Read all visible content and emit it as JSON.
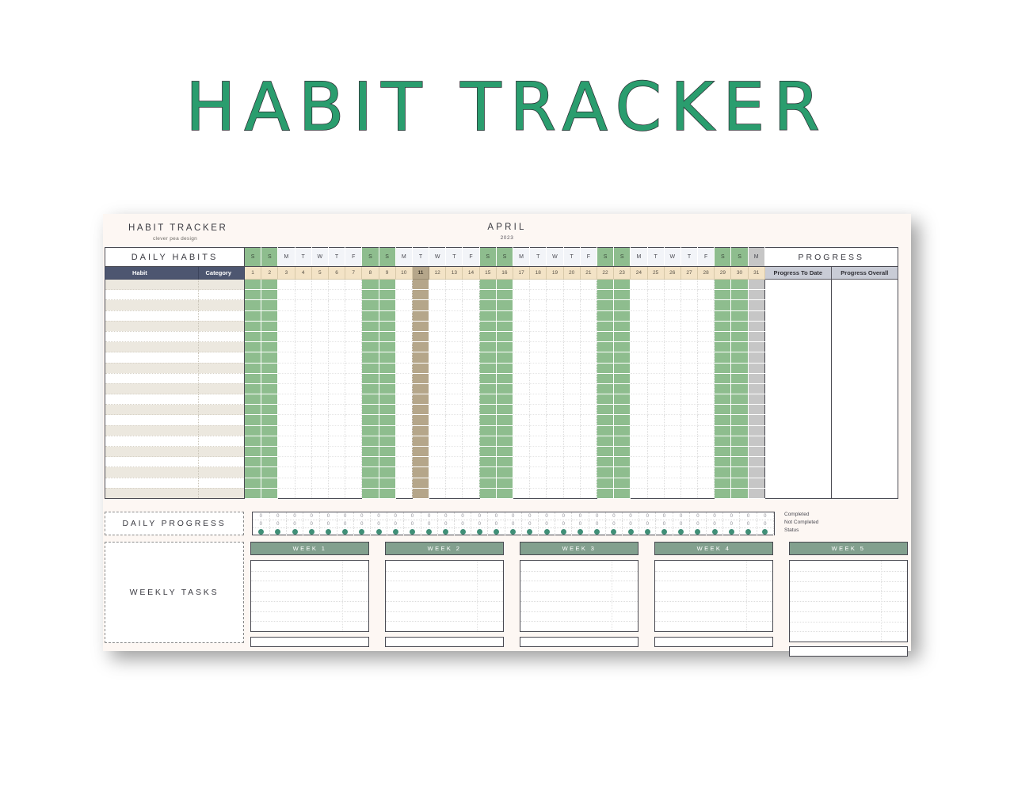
{
  "poster": {
    "title": "HABIT TRACKER",
    "title_color": "#2a9d6e",
    "outline_color": "#2f2f35",
    "background": "#ffffff"
  },
  "sheet": {
    "brand_title": "HABIT TRACKER",
    "brand_subtitle": "clever pea design",
    "month": "APRIL",
    "year": "2023",
    "background": "#fdf7f3"
  },
  "headers": {
    "daily_habits": "DAILY HABITS",
    "progress": "PROGRESS",
    "habit_col": "Habit",
    "category_col": "Category",
    "progress_to_date": "Progress To Date",
    "progress_overall": "Progress Overall"
  },
  "calendar": {
    "weekday_letters": [
      "S",
      "S",
      "M",
      "T",
      "W",
      "T",
      "F",
      "S",
      "S",
      "M",
      "T",
      "W",
      "T",
      "F",
      "S",
      "S",
      "M",
      "T",
      "W",
      "T",
      "F",
      "S",
      "S",
      "M",
      "T",
      "W",
      "T",
      "F",
      "S",
      "S",
      "M"
    ],
    "day_numbers": [
      1,
      2,
      3,
      4,
      5,
      6,
      7,
      8,
      9,
      10,
      11,
      12,
      13,
      14,
      15,
      16,
      17,
      18,
      19,
      20,
      21,
      22,
      23,
      24,
      25,
      26,
      27,
      28,
      29,
      30,
      31
    ],
    "weekend_days": [
      1,
      2,
      8,
      9,
      15,
      16,
      22,
      23,
      29,
      30
    ],
    "today": 11,
    "out_of_month_days": [
      31
    ],
    "habit_row_count": 21,
    "colors": {
      "weekend": "#8ebd8e",
      "weekday_header": "#f2f4f8",
      "today": "#b5a68a",
      "out_of_month": "#c6c6c6",
      "day_number_band": "#f3e3c6",
      "habit_header_bar": "#4d5670",
      "progress_header": "#c9ccd6",
      "row_alt": "#ece8df"
    }
  },
  "daily_progress": {
    "label": "DAILY PROGRESS",
    "completed_label": "Completed",
    "not_completed_label": "Not Completed",
    "status_label": "Status",
    "completed_values": [
      0,
      0,
      0,
      0,
      0,
      0,
      0,
      0,
      0,
      0,
      0,
      0,
      0,
      0,
      0,
      0,
      0,
      0,
      0,
      0,
      0,
      0,
      0,
      0,
      0,
      0,
      0,
      0,
      0,
      0,
      0
    ],
    "not_completed_values": [
      0,
      0,
      0,
      0,
      0,
      0,
      0,
      0,
      0,
      0,
      0,
      0,
      0,
      0,
      0,
      0,
      0,
      0,
      0,
      0,
      0,
      0,
      0,
      0,
      0,
      0,
      0,
      0,
      0,
      0,
      0
    ],
    "status_dot_color": "#3f8f77"
  },
  "weekly_tasks": {
    "label": "WEEKLY TASKS",
    "weeks": [
      {
        "label": "WEEK 1"
      },
      {
        "label": "WEEK 2"
      },
      {
        "label": "WEEK 3"
      },
      {
        "label": "WEEK 4"
      },
      {
        "label": "WEEK 5"
      }
    ],
    "header_color": "#82a08e"
  }
}
